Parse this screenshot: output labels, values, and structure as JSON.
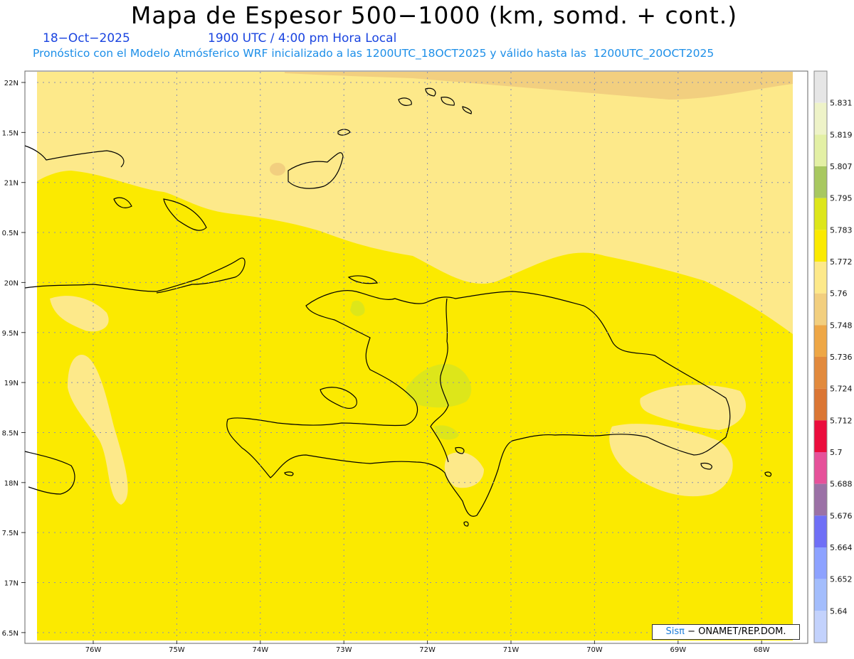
{
  "header": {
    "title": "Mapa de Espesor 500−1000 (km, somd. + cont.)",
    "date": "18−Oct−2025",
    "time": "1900 UTC / 4:00 pm Hora Local",
    "forecast": "Pronóstico con el Modelo Atmósferico WRF inicializado a las 1200UTC_18OCT2025 y válido hasta las  1200UTC_20OCT2025"
  },
  "axes": {
    "lat_labels": [
      "22N",
      "1.5N",
      "21N",
      "0.5N",
      "20N",
      "9.5N",
      "19N",
      "8.5N",
      "18N",
      "7.5N",
      "17N",
      "6.5N"
    ],
    "lon_labels": [
      "76W",
      "75W",
      "74W",
      "73W",
      "72W",
      "71W",
      "70W",
      "69W",
      "68W"
    ]
  },
  "colorbar": {
    "labels": [
      "5.831",
      "5.819",
      "5.807",
      "5.795",
      "5.783",
      "5.772",
      "5.76",
      "5.748",
      "5.736",
      "5.724",
      "5.712",
      "5.7",
      "5.688",
      "5.676",
      "5.664",
      "5.652",
      "5.64"
    ],
    "colors": [
      "#e6e6e6",
      "#eef3c8",
      "#e3f0a5",
      "#a8c860",
      "#dde61a",
      "#fbea00",
      "#fde98a",
      "#f2cf7f",
      "#eea746",
      "#e28a3d",
      "#db7634",
      "#eb0c3c",
      "#e6519a",
      "#9b71a6",
      "#6f6ff6",
      "#8da2ff",
      "#a3bdfc",
      "#c3d2fc"
    ]
  },
  "colors": {
    "fill_main": "#fbea00",
    "fill_light": "#fde98a",
    "fill_orange": "#f2cf7f",
    "fill_green": "#dde61a",
    "coast": "#000000",
    "grid": "#8a8fb4"
  },
  "credit": {
    "brand": "Sisπ",
    "text": "− ONAMET/REP.DOM."
  }
}
